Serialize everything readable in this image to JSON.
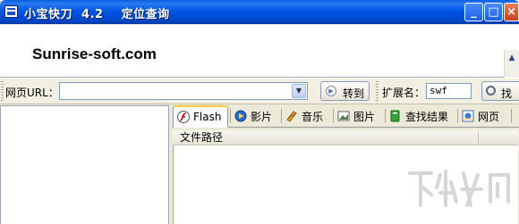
{
  "window": {
    "title": "小宝快刀  4.2    定位查询",
    "minimize": "_",
    "maximize": "□",
    "close": "×"
  },
  "preview": {
    "site_text": "Sunrise-soft.com"
  },
  "toolbar": {
    "url_label": "网页URL：",
    "url_value": "",
    "goto_label": "转到",
    "ext_label": "扩展名：",
    "ext_value": "swf",
    "find_label": "找"
  },
  "tabs": [
    {
      "label": "Flash",
      "icon": "flash-icon"
    },
    {
      "label": "影片",
      "icon": "movie-icon"
    },
    {
      "label": "音乐",
      "icon": "music-icon"
    },
    {
      "label": "图片",
      "icon": "picture-icon"
    },
    {
      "label": "查找结果",
      "icon": "find-results-icon"
    },
    {
      "label": "网页",
      "icon": "webpage-icon"
    }
  ],
  "list": {
    "column_header": "文件路径"
  },
  "colors": {
    "title_bar": "#0055e5",
    "active_tab_highlight": "#ffc83c"
  }
}
